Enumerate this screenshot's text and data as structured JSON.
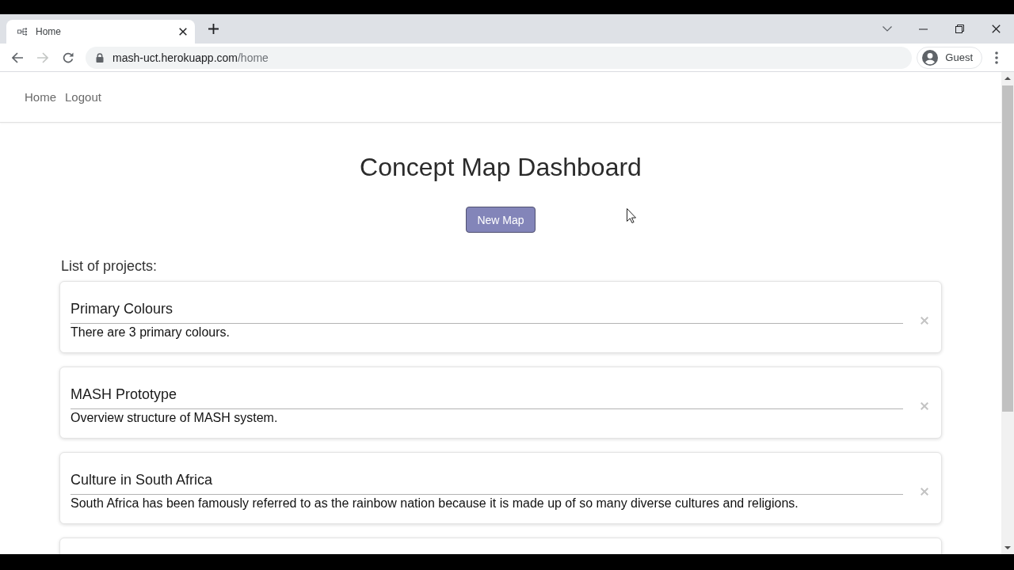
{
  "browser": {
    "tabs": [
      {
        "title": "Home",
        "selected": true
      }
    ],
    "forward": {
      "disabled": true
    },
    "address": {
      "host": "mash-uct.herokuapp.com",
      "path": "/home"
    },
    "profile": {
      "label": "Guest"
    }
  },
  "navbar": {
    "links": [
      {
        "label": "Home"
      },
      {
        "label": "Logout"
      }
    ]
  },
  "page": {
    "title": "Concept Map Dashboard",
    "new_button": "New Map",
    "list_heading": "List of projects:"
  },
  "projects": [
    {
      "title": "Primary Colours",
      "description": "There are 3 primary colours."
    },
    {
      "title": "MASH Prototype",
      "description": "Overview structure of MASH system."
    },
    {
      "title": "Culture in South Africa",
      "description": "South Africa has been famously referred to as the rainbow nation because it is made up of so many diverse cultures and religions."
    }
  ],
  "more_cards_below": true
}
